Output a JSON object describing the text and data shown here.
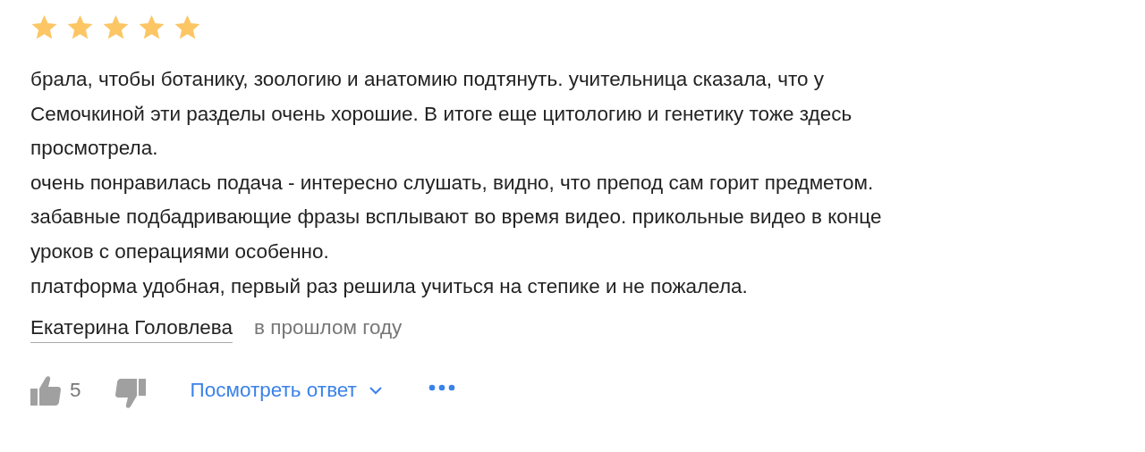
{
  "review": {
    "stars": 5,
    "lines": [
      "брала, чтобы ботанику, зоологию и анатомию подтянуть. учительница сказала, что у",
      "Семочкиной эти разделы очень хорошие. В итоге еще цитологию и генетику тоже здесь",
      "просмотрела.",
      "очень понравилась подача - интересно слушать, видно, что препод сам горит предметом.",
      "забавные подбадривающие фразы всплывают во время видео. прикольные видео в конце",
      "уроков с операциями особенно.",
      "платформа удобная, первый раз решила учиться на степике и не пожалела."
    ],
    "author": "Екатерина Головлева",
    "date": "в прошлом году",
    "likes": "5",
    "reply_link": "Посмотреть ответ"
  }
}
